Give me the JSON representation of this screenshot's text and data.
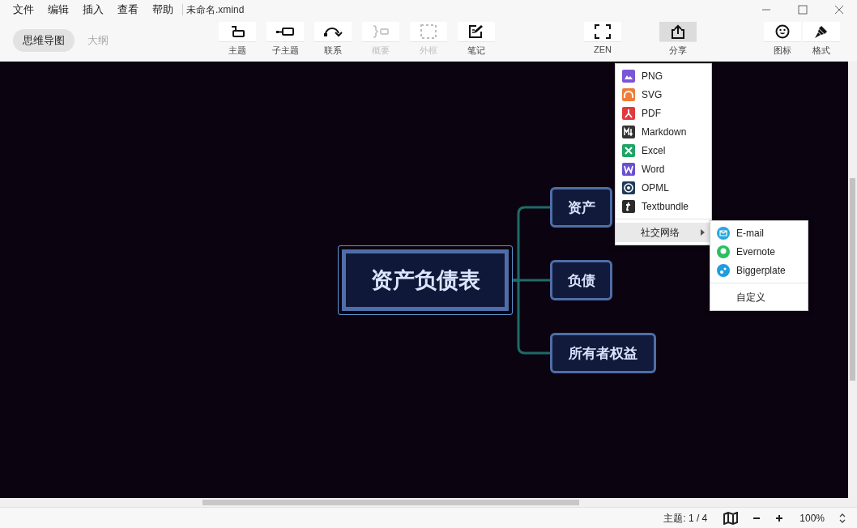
{
  "window": {
    "title": "未命名.xmind"
  },
  "menu": [
    "文件",
    "编辑",
    "插入",
    "查看",
    "帮助"
  ],
  "view_tabs": [
    {
      "label": "思维导图",
      "selected": true
    },
    {
      "label": "大纲",
      "selected": false
    }
  ],
  "toolbar": {
    "main": [
      {
        "kind": "topic",
        "label": "主题",
        "disabled": false
      },
      {
        "kind": "subtopic",
        "label": "子主题",
        "disabled": false
      },
      {
        "kind": "relationship",
        "label": "联系",
        "disabled": false
      },
      {
        "kind": "summary",
        "label": "概要",
        "disabled": true
      },
      {
        "kind": "boundary",
        "label": "外框",
        "disabled": true
      },
      {
        "kind": "note",
        "label": "笔记",
        "disabled": false
      }
    ],
    "center": [
      {
        "kind": "zen",
        "label": "ZEN",
        "pressed": false
      },
      {
        "kind": "share",
        "label": "分享",
        "pressed": true
      }
    ],
    "right": [
      {
        "kind": "smiley",
        "label": "图标"
      },
      {
        "kind": "format",
        "label": "格式"
      }
    ]
  },
  "mindmap": {
    "root": {
      "label": "资产负债表",
      "selected": true
    },
    "children": [
      {
        "label": "资产"
      },
      {
        "label": "负债"
      },
      {
        "label": "所有者权益"
      }
    ]
  },
  "export_menu": {
    "items": [
      {
        "kind": "png",
        "label": "PNG"
      },
      {
        "kind": "svg",
        "label": "SVG"
      },
      {
        "kind": "pdf",
        "label": "PDF"
      },
      {
        "kind": "markdown",
        "label": "Markdown"
      },
      {
        "kind": "excel",
        "label": "Excel"
      },
      {
        "kind": "word",
        "label": "Word"
      },
      {
        "kind": "opml",
        "label": "OPML"
      },
      {
        "kind": "textbundle",
        "label": "Textbundle"
      }
    ],
    "social": {
      "label": "社交网络",
      "expanded": true
    },
    "social_menu": {
      "items": [
        {
          "kind": "email",
          "label": "E-mail"
        },
        {
          "kind": "evernote",
          "label": "Evernote"
        },
        {
          "kind": "biggerplate",
          "label": "Biggerplate"
        }
      ],
      "custom": "自定义"
    }
  },
  "status_bar": {
    "topic_count": "主题: 1 / 4",
    "zoom": "100%"
  }
}
